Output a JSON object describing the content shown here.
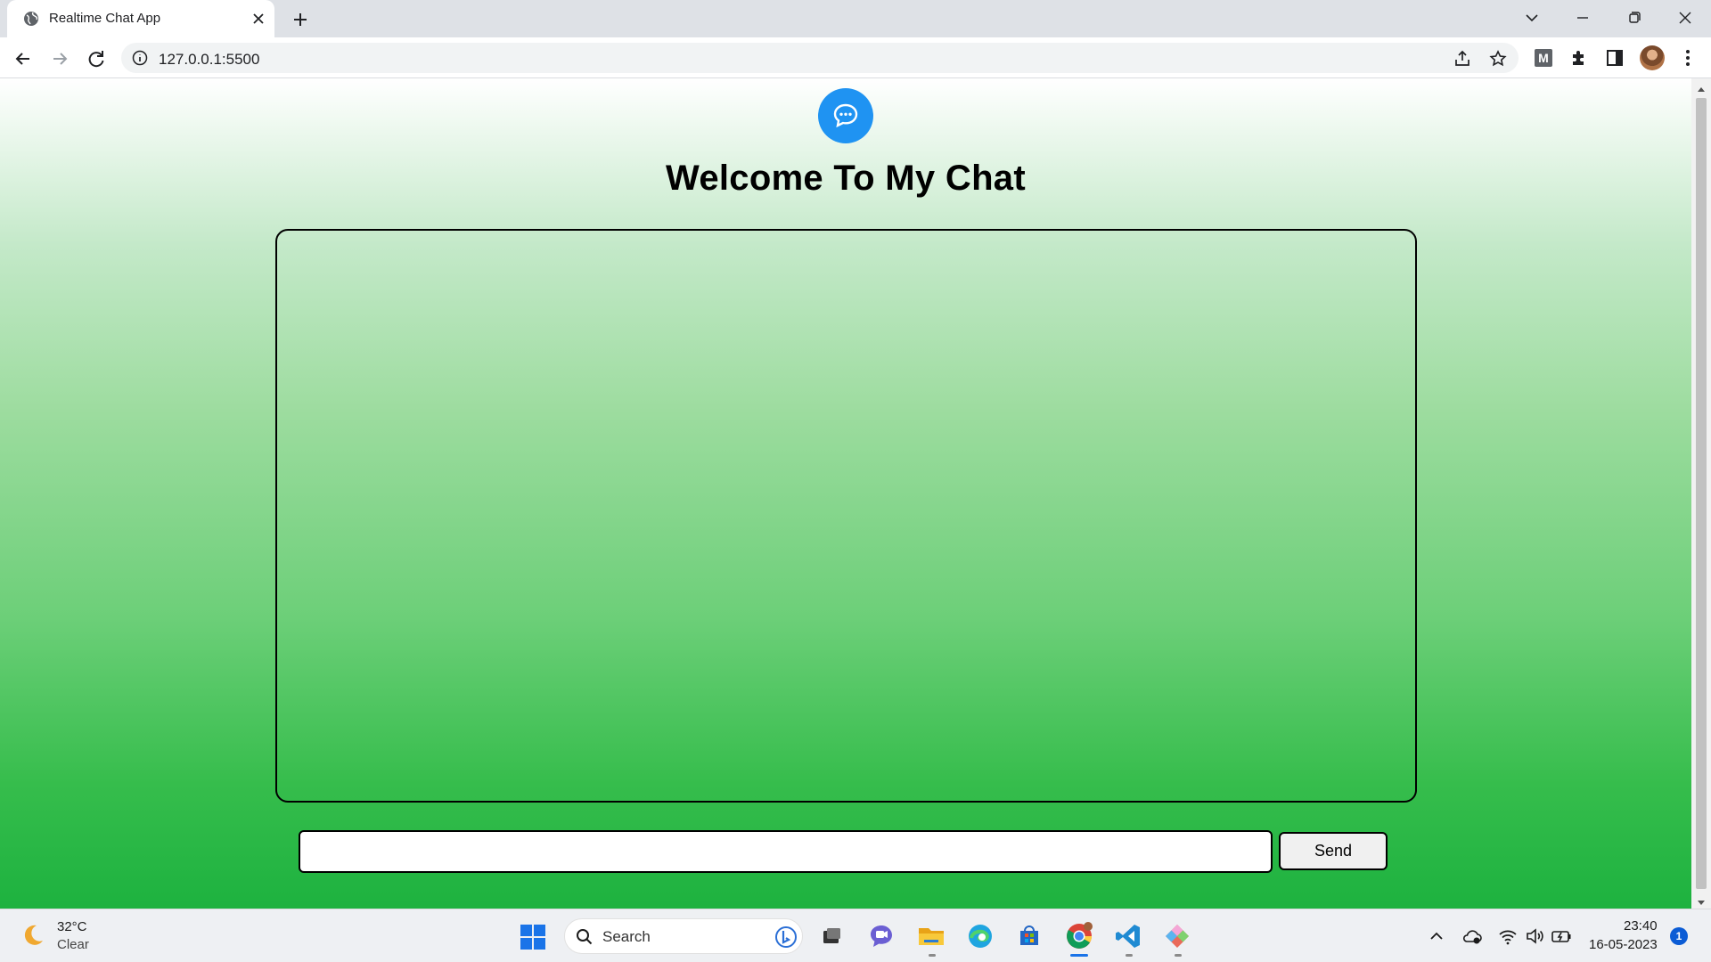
{
  "browser": {
    "tab_title": "Realtime Chat App",
    "url": "127.0.0.1:5500",
    "extension_badge": "M"
  },
  "page": {
    "title": "Welcome To My Chat",
    "message_input_value": "",
    "send_label": "Send"
  },
  "taskbar": {
    "weather_temp": "32°C",
    "weather_condition": "Clear",
    "search_label": "Search",
    "clock_time": "23:40",
    "clock_date": "16-05-2023",
    "notification_count": "1"
  },
  "colors": {
    "logo_blue": "#1f93f2",
    "page_gradient_top": "#ffffff",
    "page_gradient_bottom": "#1db23f",
    "taskbar_bg": "#eef0f3"
  },
  "icons": {
    "tab_favicon": "globe-icon",
    "chat_logo": "chat-bubbles-icon",
    "weather": "moon-icon"
  }
}
